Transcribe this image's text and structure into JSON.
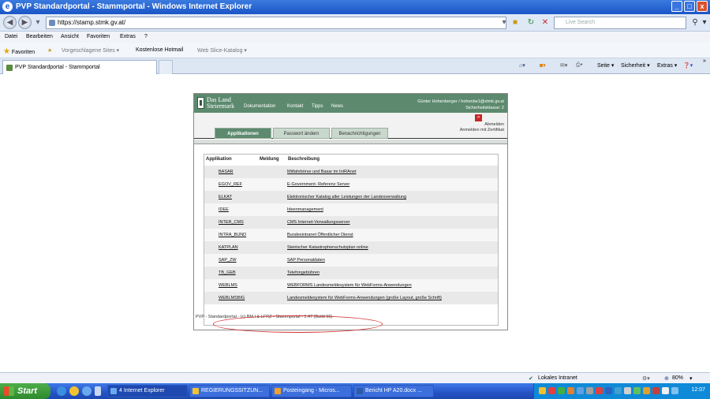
{
  "window": {
    "title": "PVP Standardportal - Stammportal - Windows Internet Explorer",
    "controls": [
      "_",
      "□",
      "x"
    ]
  },
  "addressbar": {
    "url": "https://stamp.stmk.gv.at/",
    "search_placeholder": "Live Search"
  },
  "menubar": {
    "items": [
      "Datei",
      "Bearbeiten",
      "Ansicht",
      "Favoriten",
      "Extras",
      "?"
    ]
  },
  "favoritesbar": {
    "favorites_label": "Favoriten",
    "items": [
      "Vorgeschlagene Sites ▾",
      "Kostenlose Hotmail",
      "Web Slice-Katalog ▾"
    ]
  },
  "tabbar": {
    "tab_label": "PVP Standardportal - Stammportal",
    "commands": [
      "Seite ▾",
      "Sicherheit ▾",
      "Extras ▾"
    ]
  },
  "portal": {
    "logo_line1": "Das Land",
    "logo_line2": "Steiermark",
    "nav": [
      "Dokumentation",
      "Kontakt",
      "Tipps",
      "News"
    ],
    "user_line1": "Günter Hohenberger / hohenbe1@stmk.gv.at",
    "user_line2": "Sicherheitsklasse: 2",
    "tabs": [
      "Applikationen",
      "Passwort ändern",
      "Benachrichtigungen"
    ],
    "logout_line1": "Abmelden",
    "logout_line2": "Anmelden mit Zertifikat",
    "table_headers": [
      "Applikation",
      "Meldung",
      "Beschreibung"
    ],
    "rows": [
      {
        "app": "BASAR",
        "desc": "Mitfahrbörse und Basar im IntRAnet"
      },
      {
        "app": "EGOV_REF",
        "desc": "E-Government- Referenz Server"
      },
      {
        "app": "ELKAT",
        "desc": "Elektronischer Katalog aller Leistungen der Landesverwaltung"
      },
      {
        "app": "IDEE",
        "desc": "Ideenmanagement"
      },
      {
        "app": "INTER_CMS",
        "desc": "CMS Internet-Verwaltungsserver"
      },
      {
        "app": "INTRA_BUND",
        "desc": "Bundesintranet Öffentlicher Dienst"
      },
      {
        "app": "KATPLAN",
        "desc": "Steirischer Katastrophenschutzplan online"
      },
      {
        "app": "SAP_ZW",
        "desc": "SAP Personaldaten"
      },
      {
        "app": "TB_GEB",
        "desc": "Telefongebühren"
      },
      {
        "app": "WEBLMS",
        "desc": "WEBFORMS Landesmeldesystem für WebForms-Anwendungen"
      },
      {
        "app": "WEBLMSBIG",
        "desc": "Landesmeldesystem für WebForms-Anwendungen (große Layout, große Schrift)"
      }
    ],
    "footer": "PVP - Standardportal - (c) BM.I & LFRZ - Stammportal - 1.47 (Build 90)"
  },
  "statusbar": {
    "zone": "Lokales Intranet",
    "zoom": "80%"
  },
  "taskbar": {
    "start_label": "Start",
    "buttons": [
      "4 Internet Explorer",
      "REGIERUNGSSITZUN...",
      "Posteingang - Micros...",
      "Bericht HP A20.docx ..."
    ],
    "clock": "12:07"
  }
}
